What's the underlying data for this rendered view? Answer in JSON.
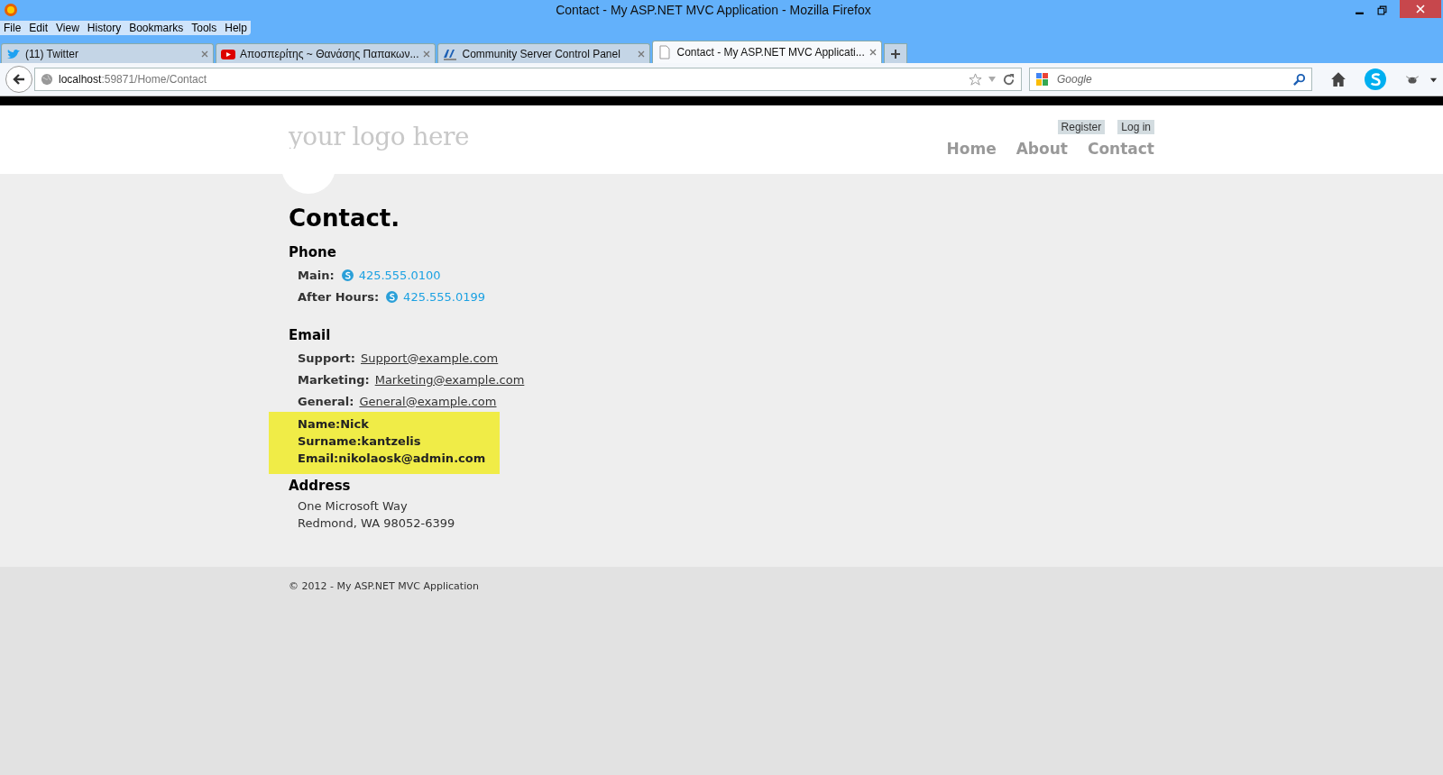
{
  "window": {
    "title": "Contact - My ASP.NET MVC Application - Mozilla Firefox"
  },
  "menu": [
    "File",
    "Edit",
    "View",
    "History",
    "Bookmarks",
    "Tools",
    "Help"
  ],
  "tabs": [
    {
      "label": "(11) Twitter",
      "selected": false,
      "kind": "bird"
    },
    {
      "label": "Αποσπερίτης ~ Θανάσης Παπακων...",
      "selected": false,
      "kind": "video"
    },
    {
      "label": "Community Server Control Panel",
      "selected": false,
      "kind": "net"
    },
    {
      "label": "Contact - My ASP.NET MVC Applicati...",
      "selected": true,
      "kind": "page"
    }
  ],
  "address": {
    "host": "localhost",
    "path": ":59871/Home/Contact"
  },
  "search": {
    "placeholder": "Google"
  },
  "site": {
    "logo": "your logo here",
    "auth": [
      "Register",
      "Log in"
    ],
    "nav": [
      "Home",
      "About",
      "Contact"
    ],
    "heading": "Contact.",
    "phone": {
      "title": "Phone",
      "rows": [
        {
          "label": "Main:",
          "number": "425.555.0100"
        },
        {
          "label": "After Hours:",
          "number": "425.555.0199"
        }
      ]
    },
    "email": {
      "title": "Email",
      "rows": [
        {
          "label": "Support:",
          "address": "Support@example.com"
        },
        {
          "label": "Marketing:",
          "address": "Marketing@example.com"
        },
        {
          "label": "General:",
          "address": "General@example.com"
        }
      ]
    },
    "highlight": [
      "Name:Nick",
      "Surname:kantzelis",
      "Email:nikolaosk@admin.com"
    ],
    "address": {
      "title": "Address",
      "lines": [
        "One Microsoft Way",
        "Redmond, WA 98052-6399"
      ]
    },
    "footer": "© 2012 - My ASP.NET MVC Application"
  }
}
